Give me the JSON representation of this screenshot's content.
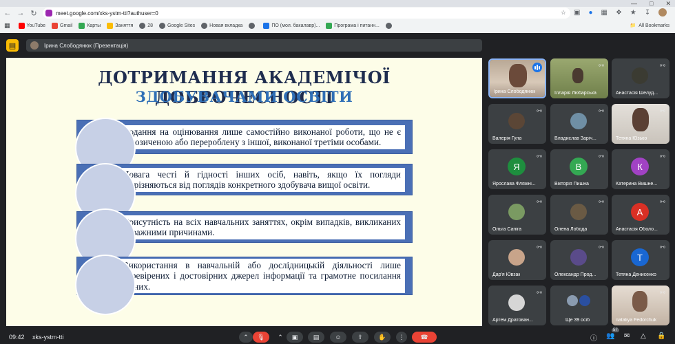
{
  "browser": {
    "url": "meet.google.com/xks-ystm-tti?authuser=0",
    "bookmarks": [
      {
        "label": "YouTube",
        "color": "#ff0000"
      },
      {
        "label": "Gmail",
        "color": "#ea4335"
      },
      {
        "label": "Карты",
        "color": "#34a853"
      },
      {
        "label": "Заняття",
        "color": "#fbbc04"
      },
      {
        "label": "28",
        "color": "#5f6368"
      },
      {
        "label": "Google Sites",
        "color": "#5f6368"
      },
      {
        "label": "Новая вкладка",
        "color": "#5f6368"
      },
      {
        "label": "",
        "color": "#5f6368"
      },
      {
        "label": "ПО (мол. бакалавр)...",
        "color": "#1a73e8"
      },
      {
        "label": "Програма і питанн...",
        "color": "#34a853"
      },
      {
        "label": "",
        "color": "#5f6368"
      }
    ],
    "all_bookmarks": "All Bookmarks"
  },
  "presentation": {
    "presenter": "Ірина Слободянюк (Презентація)"
  },
  "slide": {
    "title_line1": "ДОТРИМАННЯ АКАДЕМІЧОЇ ДОБРОЧЕСНОСТІ",
    "title_line2": "ЗДОБУВАЧАМИ ОСВІТИ",
    "bullets": [
      "Подання на оцінювання лише самостійно виконаної роботи, що не є запозиченою або перероблену з іншої, виконаної третіми особами.",
      "Повага честі й гідності інших осіб, навіть, якщо їх погляди відрізняються від поглядів конкретного здобувача вищої освіти.",
      "Присутність на всіх навчальних заняттях, окрім випадків, викликаних поважними причинами.",
      "Використання в навчальній або дослідницькій діяльності лише перевірених і достовірних джерел інформації та грамотне посилання на них."
    ]
  },
  "participants": [
    {
      "name": "Ірина Слободянюк",
      "type": "video",
      "color": "#c9b8a8",
      "speaking": true
    },
    {
      "name": "Ілларія Любарська",
      "type": "video",
      "color": "#7c8a58"
    },
    {
      "name": "Анастасія Шелуд...",
      "type": "photo",
      "color": "#3b3b32"
    },
    {
      "name": "Валерія Гула",
      "type": "photo",
      "color": "#5b4636"
    },
    {
      "name": "Владислав Заріч...",
      "type": "photo",
      "color": "#6f8fa5"
    },
    {
      "name": "Тетяна Юзько",
      "type": "video",
      "color": "#d8d3cc"
    },
    {
      "name": "Ярослава Фляжні...",
      "type": "letter",
      "letter": "Я",
      "color": "#1e8e3e"
    },
    {
      "name": "Вікторія Пишна",
      "type": "letter",
      "letter": "В",
      "color": "#34a853"
    },
    {
      "name": "Катерина Вишне...",
      "type": "letter",
      "letter": "К",
      "color": "#a142c4"
    },
    {
      "name": "Ольга Сапіга",
      "type": "photo",
      "color": "#7a9a62"
    },
    {
      "name": "Олена Лобода",
      "type": "photo",
      "color": "#6a5a44"
    },
    {
      "name": "Анастасія Оболо...",
      "type": "letter",
      "letter": "А",
      "color": "#d93025"
    },
    {
      "name": "Дар'я Ювзак",
      "type": "photo",
      "color": "#c8a48a"
    },
    {
      "name": "Олександр Прод...",
      "type": "photo",
      "color": "#5a4b8a"
    },
    {
      "name": "Тетяна Денисенко",
      "type": "letter",
      "letter": "Т",
      "color": "#1967d2"
    },
    {
      "name": "Артем Дратован...",
      "type": "photo",
      "color": "#d6d6d6"
    },
    {
      "name": "Ще 39 осіб",
      "type": "group",
      "color": "#4a6fb5"
    },
    {
      "name": "nataliya Fedorchuk",
      "type": "video",
      "color": "#cdbfb2"
    }
  ],
  "bottom": {
    "time": "09:42",
    "meeting_code": "xks-ystm-tti",
    "participant_count": "57"
  }
}
